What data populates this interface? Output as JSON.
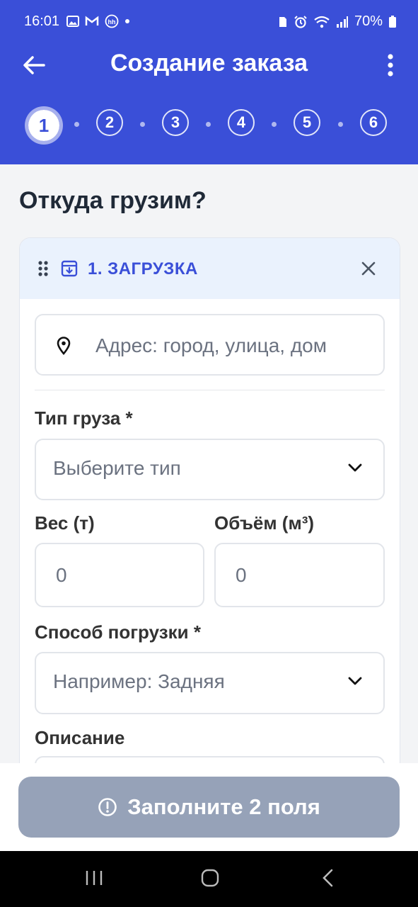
{
  "status_bar": {
    "time": "16:01",
    "battery": "70%"
  },
  "app_bar": {
    "title": "Создание заказа"
  },
  "steps": [
    "1",
    "2",
    "3",
    "4",
    "5",
    "6"
  ],
  "page": {
    "heading": "Откуда грузим?"
  },
  "card": {
    "title": "1. ЗАГРУЗКА",
    "address_placeholder": "Адрес: город, улица, дом",
    "cargo_type_label": "Тип груза *",
    "cargo_type_placeholder": "Выберите тип",
    "weight_label": "Вес (т)",
    "weight_value": "0",
    "volume_label": "Объём (м³)",
    "volume_value": "0",
    "loading_method_label": "Способ погрузки *",
    "loading_method_placeholder": "Например: Задняя",
    "description_label": "Описание"
  },
  "submit": {
    "label": "Заполните 2 поля"
  },
  "colors": {
    "primary": "#3a4fd8",
    "card_header": "#eaf2fd",
    "disabled_button": "#96a2b8"
  }
}
